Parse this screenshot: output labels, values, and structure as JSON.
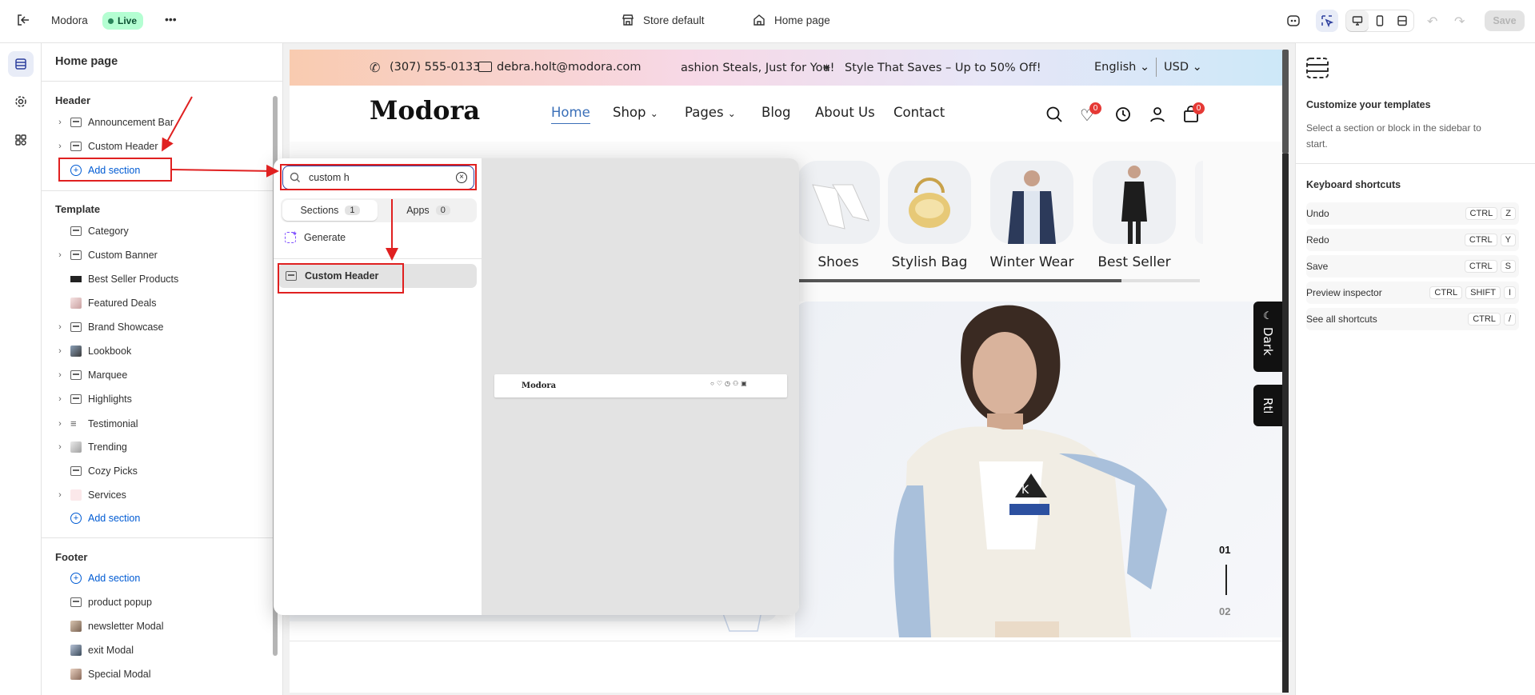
{
  "topbar": {
    "store_name": "Modora",
    "live_badge": "Live",
    "more": "•••",
    "store_selector": "Store default",
    "page_selector": "Home page",
    "save_label": "Save"
  },
  "sidebar": {
    "title": "Home page",
    "header_group": "Header",
    "header_items": [
      "Announcement Bar",
      "Custom Header"
    ],
    "add_section": "Add section",
    "template_group": "Template",
    "template_items": [
      "Category",
      "Custom Banner",
      "Best Seller Products",
      "Featured Deals",
      "Brand Showcase",
      "Lookbook",
      "Marquee",
      "Highlights",
      "Testimonial",
      "Trending",
      "Cozy Picks",
      "Services"
    ],
    "footer_group": "Footer",
    "footer_items": [
      "product popup",
      "newsletter Modal",
      "exit Modal",
      "Special Modal"
    ]
  },
  "popover": {
    "search_value": "custom h",
    "tab_sections": "Sections",
    "tab_sections_count": "1",
    "tab_apps": "Apps",
    "tab_apps_count": "0",
    "generate": "Generate",
    "result": "Custom Header",
    "preview_logo": "Modora"
  },
  "store": {
    "phone": "(307) 555-0133",
    "email": "debra.holt@modora.com",
    "marquee_1": "ashion Steals, Just for You!",
    "marquee_star": "✷",
    "marquee_2": "Style That Saves – Up to 50% Off!",
    "language": "English",
    "currency": "USD",
    "logo": "Modora",
    "nav": [
      "Home",
      "Shop",
      "Pages",
      "Blog",
      "About Us",
      "Contact"
    ],
    "wishlist_count": "0",
    "cart_count": "0",
    "categories": [
      "Shoes",
      "Stylish Bag",
      "Winter Wear",
      "Best Seller"
    ],
    "dark_toggle": "Dark",
    "rtl_toggle": "Rtl",
    "slide_current": "01",
    "slide_next": "02",
    "accent_color": "#3a6fb8"
  },
  "rightpanel": {
    "title": "Customize your templates",
    "description": "Select a section or block in the sidebar to start.",
    "shortcuts_title": "Keyboard shortcuts",
    "shortcuts": [
      {
        "label": "Undo",
        "keys": [
          "CTRL",
          "Z"
        ]
      },
      {
        "label": "Redo",
        "keys": [
          "CTRL",
          "Y"
        ]
      },
      {
        "label": "Save",
        "keys": [
          "CTRL",
          "S"
        ]
      },
      {
        "label": "Preview inspector",
        "keys": [
          "CTRL",
          "SHIFT",
          "I"
        ]
      },
      {
        "label": "See all shortcuts",
        "keys": [
          "CTRL",
          "/"
        ]
      }
    ]
  }
}
